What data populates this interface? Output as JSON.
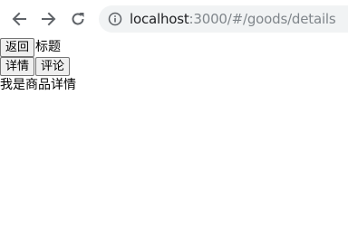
{
  "browser": {
    "url_host": "localhost",
    "url_path": ":3000/#/goods/details",
    "icons": {
      "back": "arrow-left-icon",
      "forward": "arrow-right-icon",
      "reload": "reload-icon",
      "info": "info-icon"
    }
  },
  "header": {
    "back_label": "返回",
    "title": "标题"
  },
  "tabs": [
    {
      "label": "详情"
    },
    {
      "label": "评论"
    }
  ],
  "main": {
    "detail_text": "我是商品详情"
  }
}
